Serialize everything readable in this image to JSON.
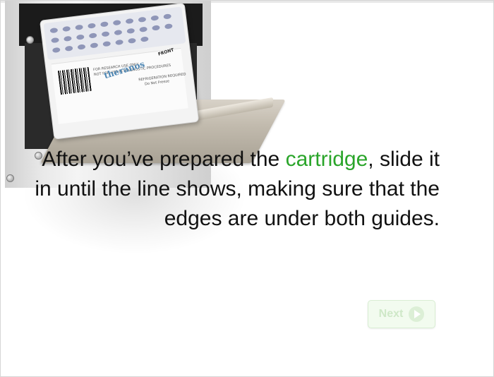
{
  "caption": {
    "part1": "After you’ve prepared the ",
    "highlight": "cartridge",
    "part2": ", slide it in until the line shows, making sure that the edges are under both guides.",
    "highlight_color": "#2aa52a"
  },
  "next_button": {
    "label": "Next",
    "icon": "play-circle-icon"
  },
  "illustration": {
    "brand": "theranos",
    "label_lines": [
      "FOR RESEARCH USE ONLY",
      "NOT FOR USE IN DIAGNOSTIC PROCEDURES"
    ],
    "notice_lines": [
      "REFRIGERATION REQUIRED",
      "Do Not Freeze"
    ],
    "front_label": "FRONT"
  }
}
